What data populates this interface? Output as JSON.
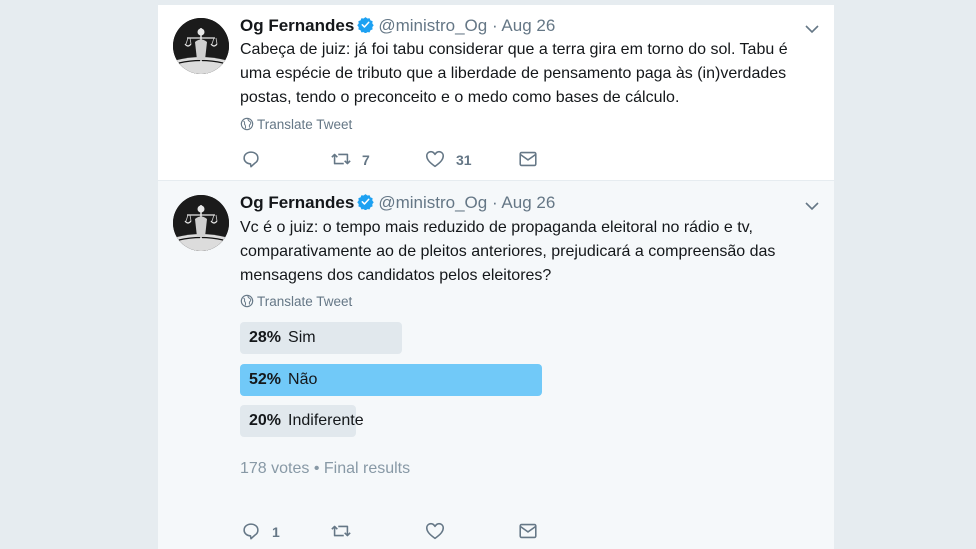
{
  "tweets": [
    {
      "author_name": "Og Fernandes",
      "handle": "@ministro_Og",
      "separator": "·",
      "date": "Aug 26",
      "text": "Cabeça de juiz: já foi tabu considerar que a terra gira em torno do sol. Tabu é uma espécie de tributo que a liberdade de pensamento paga às (in)verdades postas, tendo o preconceito e o medo como bases de cálculo.",
      "translate_label": "Translate Tweet",
      "reply_count": "",
      "retweet_count": "7",
      "like_count": "31"
    },
    {
      "author_name": "Og Fernandes",
      "handle": "@ministro_Og",
      "separator": "·",
      "date": "Aug 26",
      "text": "Vc é o juiz: o tempo mais reduzido de propaganda eleitoral no rádio e tv, comparativamente ao de  pleitos anteriores, prejudicará a compreensão das mensagens dos candidatos pelos eleitores?",
      "translate_label": "Translate Tweet",
      "poll": {
        "options": [
          {
            "percent_label": "28%",
            "label": "Sim",
            "value": 28,
            "winner": false
          },
          {
            "percent_label": "52%",
            "label": "Não",
            "value": 52,
            "winner": true
          },
          {
            "percent_label": "20%",
            "label": "Indiferente",
            "value": 20,
            "winner": false
          }
        ],
        "summary": "178 votes • Final results"
      },
      "reply_count": "1",
      "retweet_count": "",
      "like_count": ""
    }
  ],
  "colors": {
    "verified_blue": "#1da1f2",
    "poll_winner": "#71c9f8",
    "poll_bar": "#e1e8ed",
    "secondary_text": "#657786"
  },
  "icons": [
    "verified-badge-icon",
    "chevron-down-icon",
    "globe-icon",
    "reply-icon",
    "retweet-icon",
    "like-icon",
    "direct-message-icon"
  ]
}
